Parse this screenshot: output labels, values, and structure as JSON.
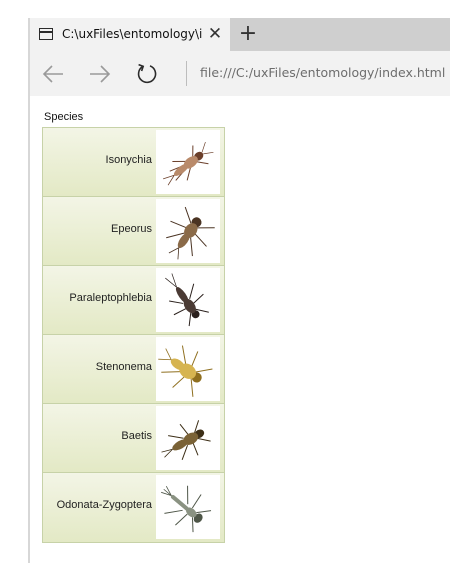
{
  "browser": {
    "tab_title": "C:\\uxFiles\\entomology\\i",
    "close_label": "✕",
    "new_tab_label": "+",
    "url": "file:///C:/uxFiles/entomology/index.html"
  },
  "page": {
    "list_label": "Species",
    "species": [
      {
        "name": "Isonychia",
        "body_color": "#b98a6a",
        "accent_color": "#6b3f2a"
      },
      {
        "name": "Epeorus",
        "body_color": "#8a6a48",
        "accent_color": "#4a3322"
      },
      {
        "name": "Paraleptophlebia",
        "body_color": "#4a3a34",
        "accent_color": "#2a201c"
      },
      {
        "name": "Stenonema",
        "body_color": "#d6b450",
        "accent_color": "#8f6f1f"
      },
      {
        "name": "Baetis",
        "body_color": "#7a6236",
        "accent_color": "#3c2e16"
      },
      {
        "name": "Odonata-Zygoptera",
        "body_color": "#8a9282",
        "accent_color": "#4e5648"
      }
    ]
  }
}
